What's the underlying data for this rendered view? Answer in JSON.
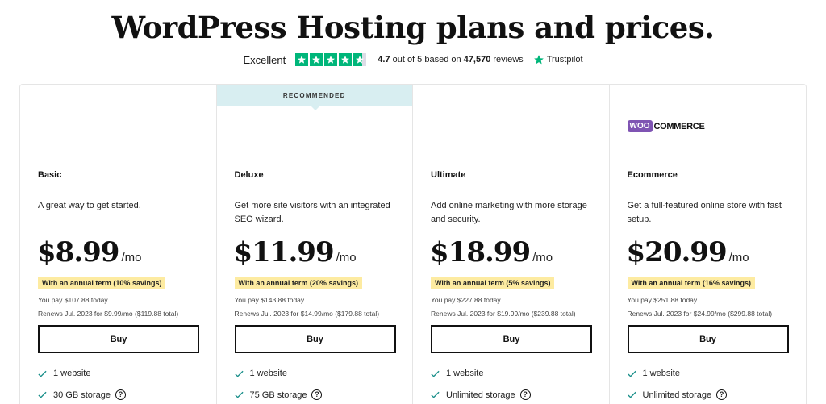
{
  "page": {
    "title": "WordPress Hosting plans and prices."
  },
  "rating": {
    "label": "Excellent",
    "stars_value": 4.7,
    "score": "4.7",
    "out_of_text": "out of 5 based on",
    "reviews_count": "47,570",
    "reviews_word": "reviews",
    "brand": "Trustpilot"
  },
  "colors": {
    "trustpilot_green": "#00b67a",
    "recommended_banner": "#d8eef1",
    "savings_badge": "#fdeba1",
    "woo_purple": "#7f54b3",
    "check_teal": "#1a8f8a"
  },
  "plans": [
    {
      "name": "Basic",
      "description": "A great way to get started.",
      "price": "$8.99",
      "period": "/mo",
      "savings": "With an annual term (10% savings)",
      "pay_today": "You pay $107.88 today",
      "renews": "Renews Jul. 2023 for $9.99/mo ($119.88 total)",
      "buy_label": "Buy",
      "features": [
        {
          "text": "1 website",
          "icon": "check-icon"
        },
        {
          "text": "30 GB storage",
          "icon": "check-icon",
          "help": "?"
        }
      ]
    },
    {
      "name": "Deluxe",
      "recommended_label": "RECOMMENDED",
      "description": "Get more site visitors with an integrated SEO wizard.",
      "price": "$11.99",
      "period": "/mo",
      "savings": "With an annual term (20% savings)",
      "pay_today": "You pay $143.88 today",
      "renews": "Renews Jul. 2023 for $14.99/mo ($179.88 total)",
      "buy_label": "Buy",
      "features": [
        {
          "text": "1 website",
          "icon": "check-icon"
        },
        {
          "text": "75 GB storage",
          "icon": "check-icon",
          "help": "?"
        }
      ]
    },
    {
      "name": "Ultimate",
      "description": "Add online marketing with more storage and security.",
      "price": "$18.99",
      "period": "/mo",
      "savings": "With an annual term (5% savings)",
      "pay_today": "You pay $227.88 today",
      "renews": "Renews Jul. 2023 for $19.99/mo ($239.88 total)",
      "buy_label": "Buy",
      "features": [
        {
          "text": "1 website",
          "icon": "check-icon"
        },
        {
          "text": "Unlimited storage",
          "icon": "check-icon",
          "help": "?"
        }
      ]
    },
    {
      "name": "Ecommerce",
      "logo_bubble": "WOO",
      "logo_text": "COMMERCE",
      "description": "Get a full-featured online store with fast setup.",
      "price": "$20.99",
      "period": "/mo",
      "savings": "With an annual term (16% savings)",
      "pay_today": "You pay $251.88 today",
      "renews": "Renews Jul. 2023 for $24.99/mo ($299.88 total)",
      "buy_label": "Buy",
      "features": [
        {
          "text": "1 website",
          "icon": "check-icon"
        },
        {
          "text": "Unlimited storage",
          "icon": "check-icon",
          "help": "?"
        }
      ]
    }
  ]
}
